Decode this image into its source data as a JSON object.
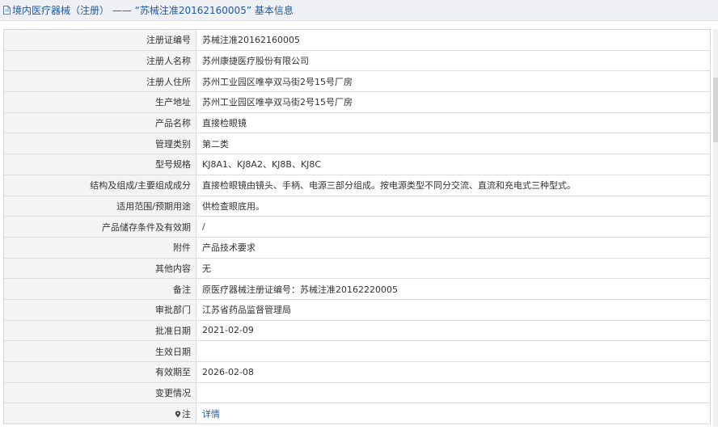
{
  "header": {
    "title": "境内医疗器械（注册） ——  “苏械注准20162160005”  基本信息",
    "icon": "document-icon"
  },
  "rows": [
    {
      "label": "注册证编号",
      "value": "苏械注准20162160005"
    },
    {
      "label": "注册人名称",
      "value": "苏州康捷医疗股份有限公司"
    },
    {
      "label": "注册人住所",
      "value": "苏州工业园区唯亭双马街2号15号厂房"
    },
    {
      "label": "生产地址",
      "value": "苏州工业园区唯亭双马街2号15号厂房"
    },
    {
      "label": "产品名称",
      "value": "直接检眼镜"
    },
    {
      "label": "管理类别",
      "value": "第二类"
    },
    {
      "label": "型号规格",
      "value": "KJ8A1、KJ8A2、KJ8B、KJ8C"
    },
    {
      "label": "结构及组成/主要组成成分",
      "value": "直接检眼镜由镜头、手柄、电源三部分组成。按电源类型不同分交流、直流和充电式三种型式。"
    },
    {
      "label": "适用范围/预期用途",
      "value": "供检查眼底用。"
    },
    {
      "label": "产品储存条件及有效期",
      "value": "/"
    },
    {
      "label": "附件",
      "value": "产品技术要求"
    },
    {
      "label": "其他内容",
      "value": "无"
    },
    {
      "label": "备注",
      "value": "原医疗器械注册证编号：苏械注准20162220005"
    },
    {
      "label": "审批部门",
      "value": "江苏省药品监督管理局"
    },
    {
      "label": "批准日期",
      "value": "2021-02-09"
    },
    {
      "label": "生效日期",
      "value": ""
    },
    {
      "label": "有效期至",
      "value": "2026-02-08"
    },
    {
      "label": "变更情况",
      "value": ""
    }
  ],
  "note_row": {
    "label": "注",
    "icon": "pin-icon",
    "link_text": "详情"
  },
  "colors": {
    "header_bg": "#eef0f4",
    "title_blue": "#1c5aa6",
    "label_bg": "#f4f4f4",
    "border": "#dcdcdc"
  }
}
